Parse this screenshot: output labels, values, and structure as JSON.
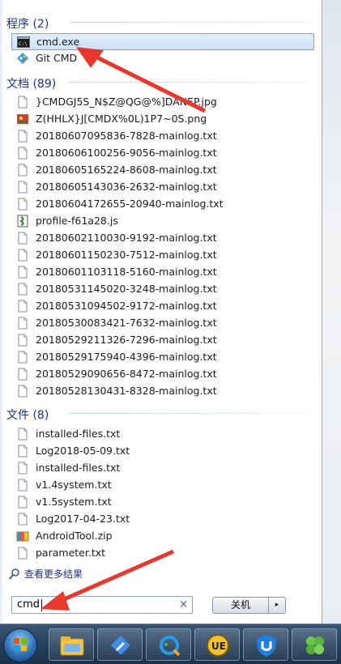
{
  "groups": {
    "programs": {
      "header": "程序 (2)",
      "items": [
        {
          "label": "cmd.exe",
          "icon": "cmd-console-icon"
        },
        {
          "label": "Git CMD",
          "icon": "git-icon"
        }
      ]
    },
    "documents": {
      "header": "文档 (89)",
      "items": [
        {
          "label": "}CMDGJ5S_N$Z@QG@%]DANEP.jpg",
          "icon": "image-file-icon"
        },
        {
          "label": "Z(HHLX}J[CMDX%0L)1P7~0S.png",
          "icon": "png-file-icon"
        },
        {
          "label": "20180607095836-7828-mainlog.txt",
          "icon": "text-file-icon"
        },
        {
          "label": "20180606100256-9056-mainlog.txt",
          "icon": "text-file-icon"
        },
        {
          "label": "20180605165224-8608-mainlog.txt",
          "icon": "text-file-icon"
        },
        {
          "label": "20180605143036-2632-mainlog.txt",
          "icon": "text-file-icon"
        },
        {
          "label": "20180604172655-20940-mainlog.txt",
          "icon": "text-file-icon"
        },
        {
          "label": "profile-f61a28.js",
          "icon": "js-file-icon"
        },
        {
          "label": "20180602110030-9192-mainlog.txt",
          "icon": "text-file-icon"
        },
        {
          "label": "20180601150230-7512-mainlog.txt",
          "icon": "text-file-icon"
        },
        {
          "label": "20180601103118-5160-mainlog.txt",
          "icon": "text-file-icon"
        },
        {
          "label": "20180531145020-3248-mainlog.txt",
          "icon": "text-file-icon"
        },
        {
          "label": "20180531094502-9172-mainlog.txt",
          "icon": "text-file-icon"
        },
        {
          "label": "20180530083421-7632-mainlog.txt",
          "icon": "text-file-icon"
        },
        {
          "label": "20180529211326-7296-mainlog.txt",
          "icon": "text-file-icon"
        },
        {
          "label": "20180529175940-4396-mainlog.txt",
          "icon": "text-file-icon"
        },
        {
          "label": "20180529090656-8472-mainlog.txt",
          "icon": "text-file-icon"
        },
        {
          "label": "20180528130431-8328-mainlog.txt",
          "icon": "text-file-icon"
        }
      ]
    },
    "files": {
      "header": "文件 (8)",
      "items": [
        {
          "label": "installed-files.txt",
          "icon": "text-file-icon"
        },
        {
          "label": "Log2018-05-09.txt",
          "icon": "text-file-icon"
        },
        {
          "label": "installed-files.txt",
          "icon": "text-file-icon"
        },
        {
          "label": "v1.4system.txt",
          "icon": "text-file-icon"
        },
        {
          "label": "v1.5system.txt",
          "icon": "text-file-icon"
        },
        {
          "label": "Log2017-04-23.txt",
          "icon": "text-file-icon"
        },
        {
          "label": "AndroidTool.zip",
          "icon": "zip-archive-icon"
        },
        {
          "label": "parameter.txt",
          "icon": "text-file-icon"
        }
      ]
    }
  },
  "see_more": "查看更多结果",
  "search": {
    "value": "cmd",
    "clear_symbol": "×"
  },
  "shutdown": {
    "label": "关机",
    "arrow_symbol": "▸"
  },
  "taskbar": {
    "items": [
      "start-orb-icon",
      "file-explorer-icon",
      "notes-app-icon",
      "browser-app-icon",
      "ultraedit-icon",
      "security-app-icon",
      "clover-app-icon"
    ]
  },
  "colors": {
    "header": "#1e3287",
    "selection": "#cde0f6",
    "annotation_arrow": "#e8382e"
  }
}
